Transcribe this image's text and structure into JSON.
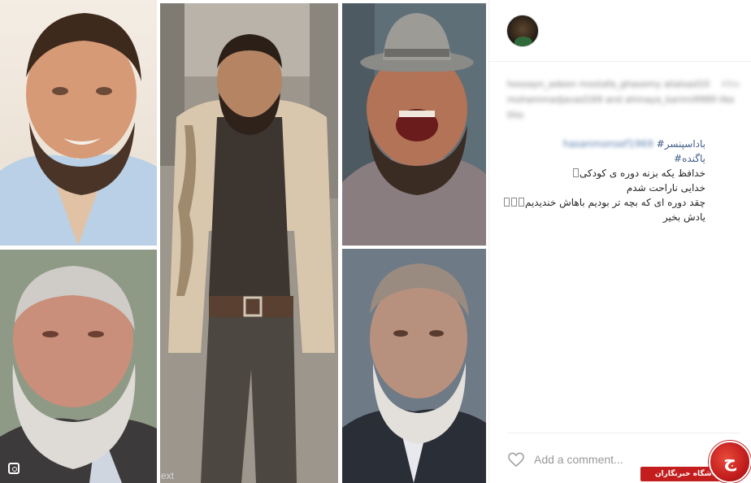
{
  "post": {
    "likes_text": "hossayn_adeen mostafa_ghasemy alialsad10 mohammadjavad169 and ahmaya_karimi9989 like this",
    "time_ago": "49w",
    "caption": {
      "username": "hasanmonsef1969",
      "hashtag_1": "باداسپنسر#",
      "hashtag_2": "یاگنده#",
      "line_1": "خدافظ یکه بزنه دوره ی کودکی",
      "line_2": "خدایی ناراحت شدم",
      "line_3": "چقد دوره ای که بچه تر بودیم باهاش خندیدیم",
      "line_4": "یادش بخیر"
    }
  },
  "photos": {
    "watermark": "ext"
  },
  "comment": {
    "placeholder": "Add a comment..."
  },
  "logo": {
    "banner_text": "باشگاه خبرنگاران",
    "badge_char": "ج"
  },
  "icons": {
    "like": "heart-icon",
    "avatar": "user-avatar",
    "collage_corner": "instagram-glyph-icon"
  },
  "colors": {
    "hashtag": "#3e5d88",
    "brand_red": "#c31d1d",
    "placeholder": "#999999"
  }
}
